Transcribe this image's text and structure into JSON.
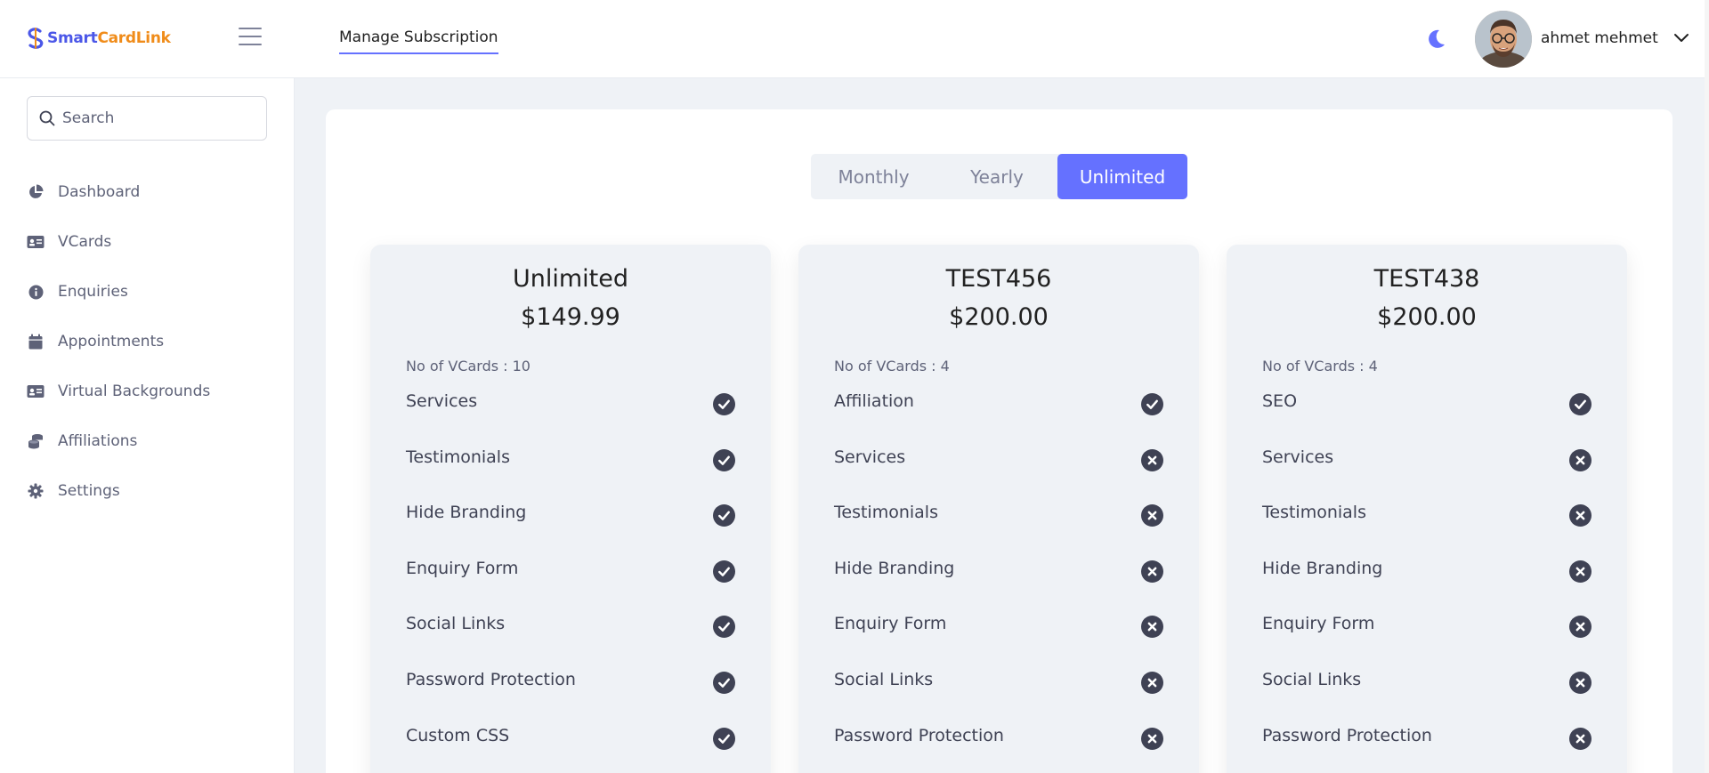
{
  "brand": {
    "part1": "Smart",
    "part2": "Card",
    "part3": "Link"
  },
  "header": {
    "tab": "Manage Subscription",
    "username": "ahmet mehmet"
  },
  "search": {
    "placeholder": "Search"
  },
  "sidebar": {
    "items": [
      {
        "label": "Dashboard",
        "icon": "pie-chart-icon"
      },
      {
        "label": "VCards",
        "icon": "id-card-icon"
      },
      {
        "label": "Enquiries",
        "icon": "info-icon"
      },
      {
        "label": "Appointments",
        "icon": "calendar-icon"
      },
      {
        "label": "Virtual Backgrounds",
        "icon": "id-card-icon"
      },
      {
        "label": "Affiliations",
        "icon": "coins-icon"
      },
      {
        "label": "Settings",
        "icon": "gear-icon"
      }
    ]
  },
  "toggle": {
    "options": [
      "Monthly",
      "Yearly",
      "Unlimited"
    ],
    "active": "Unlimited"
  },
  "colors": {
    "accent": "#6571ff",
    "check": "#3f4254"
  },
  "plans": [
    {
      "name": "Unlimited",
      "price": "$149.99",
      "vcards": "No of VCards : 10",
      "features": [
        {
          "label": "Services",
          "included": true
        },
        {
          "label": "Testimonials",
          "included": true
        },
        {
          "label": "Hide Branding",
          "included": true
        },
        {
          "label": "Enquiry Form",
          "included": true
        },
        {
          "label": "Social Links",
          "included": true
        },
        {
          "label": "Password Protection",
          "included": true
        },
        {
          "label": "Custom CSS",
          "included": true
        }
      ]
    },
    {
      "name": "TEST456",
      "price": "$200.00",
      "vcards": "No of VCards : 4",
      "features": [
        {
          "label": "Affiliation",
          "included": true
        },
        {
          "label": "Services",
          "included": false
        },
        {
          "label": "Testimonials",
          "included": false
        },
        {
          "label": "Hide Branding",
          "included": false
        },
        {
          "label": "Enquiry Form",
          "included": false
        },
        {
          "label": "Social Links",
          "included": false
        },
        {
          "label": "Password Protection",
          "included": false
        }
      ]
    },
    {
      "name": "TEST438",
      "price": "$200.00",
      "vcards": "No of VCards : 4",
      "features": [
        {
          "label": "SEO",
          "included": true
        },
        {
          "label": "Services",
          "included": false
        },
        {
          "label": "Testimonials",
          "included": false
        },
        {
          "label": "Hide Branding",
          "included": false
        },
        {
          "label": "Enquiry Form",
          "included": false
        },
        {
          "label": "Social Links",
          "included": false
        },
        {
          "label": "Password Protection",
          "included": false
        }
      ]
    }
  ]
}
